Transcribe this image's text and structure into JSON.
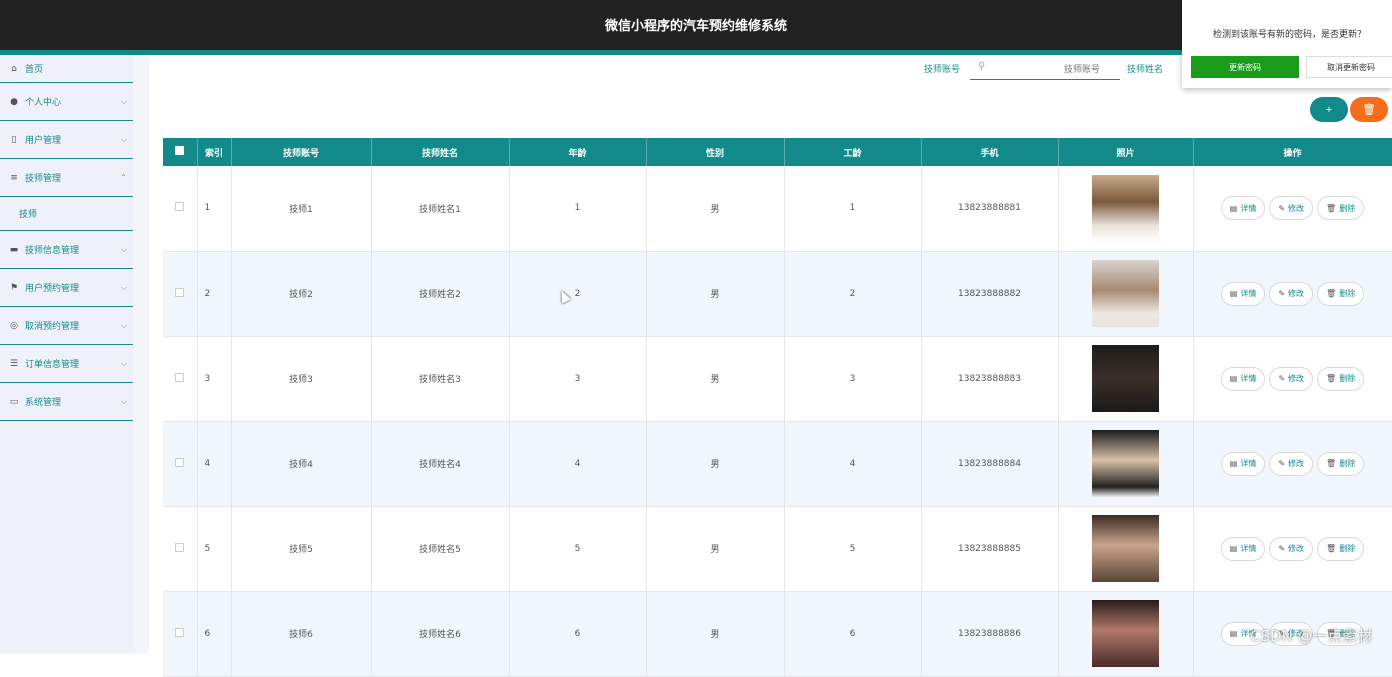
{
  "app_title": "微信小程序的汽车预约维修系统",
  "popup": {
    "message": "检测到该账号有新的密码，是否更新？",
    "confirm_label": "更新密码",
    "cancel_label": "取消更新密码"
  },
  "sidebar": {
    "items": [
      {
        "label": "首页",
        "icon": "home-icon"
      },
      {
        "label": "个人中心",
        "icon": "user-icon"
      },
      {
        "label": "用户管理",
        "icon": "phone-icon"
      },
      {
        "label": "技师管理",
        "icon": "list-icon",
        "expanded": true,
        "children": [
          "技师"
        ]
      },
      {
        "label": "技师信息管理",
        "icon": "monitor-icon"
      },
      {
        "label": "用户预约管理",
        "icon": "flag-icon"
      },
      {
        "label": "取消预约管理",
        "icon": "compass-icon"
      },
      {
        "label": "订单信息管理",
        "icon": "sliders-icon"
      },
      {
        "label": "系统管理",
        "icon": "message-icon"
      }
    ]
  },
  "search": {
    "account_label": "技师账号",
    "account_placeholder": "技师账号",
    "name_label": "技师姓名"
  },
  "table": {
    "headers": [
      "索引",
      "技师账号",
      "技师姓名",
      "年龄",
      "性别",
      "工龄",
      "手机",
      "照片",
      "操作"
    ],
    "rows": [
      {
        "index": "1",
        "account": "技师1",
        "name": "技师姓名1",
        "age": "1",
        "gender": "男",
        "years": "1",
        "phone": "13823888881"
      },
      {
        "index": "2",
        "account": "技师2",
        "name": "技师姓名2",
        "age": "2",
        "gender": "男",
        "years": "2",
        "phone": "13823888882"
      },
      {
        "index": "3",
        "account": "技师3",
        "name": "技师姓名3",
        "age": "3",
        "gender": "男",
        "years": "3",
        "phone": "13823888883"
      },
      {
        "index": "4",
        "account": "技师4",
        "name": "技师姓名4",
        "age": "4",
        "gender": "男",
        "years": "4",
        "phone": "13823888884"
      },
      {
        "index": "5",
        "account": "技师5",
        "name": "技师姓名5",
        "age": "5",
        "gender": "男",
        "years": "5",
        "phone": "13823888885"
      },
      {
        "index": "6",
        "account": "技师6",
        "name": "技师姓名6",
        "age": "6",
        "gender": "男",
        "years": "6",
        "phone": "13823888886"
      }
    ],
    "actions": {
      "detail": "详情",
      "edit": "修改",
      "delete": "删除"
    }
  },
  "toolbar": {
    "add_symbol": "+",
    "delete_symbol": "🗑"
  },
  "watermark": "CSDN @一点素材",
  "colors": {
    "accent": "#138a8a",
    "danger": "#f56c1b",
    "confirm": "#1a9b1a",
    "topbar": "#222222"
  }
}
